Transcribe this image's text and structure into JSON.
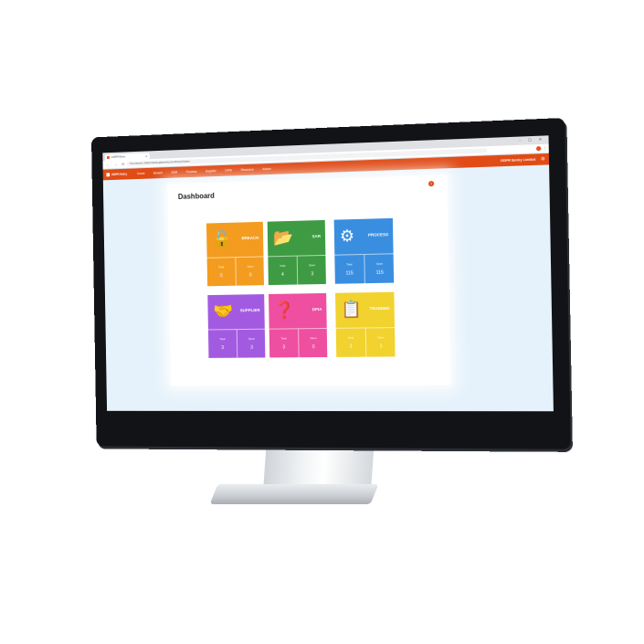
{
  "browser": {
    "tab_title": "GDPR Entry",
    "tab_close": "×",
    "window_controls": "– ▢ ✕",
    "nav_glyphs": "← → ⟳",
    "url": "Not secure | https://www.gdprentry.com/Home/Index",
    "menu_glyph": "⋮"
  },
  "app": {
    "brand": "GDPR Entry",
    "menu": [
      "Home",
      "Breach",
      "SAR",
      "Process",
      "Supplier",
      "DPIA",
      "Resource",
      "Admin"
    ],
    "company": "GDPR Sentry Limited",
    "settings_glyph": "⚙",
    "notification_count": "1"
  },
  "dashboard": {
    "title": "Dashboard",
    "tiles": [
      {
        "name": "BREACH",
        "icon": "lock-open-icon",
        "glyph": "🔓",
        "color": "#f39c1f",
        "left_label": "Total",
        "left_value": "0",
        "right_label": "Open",
        "right_value": "0"
      },
      {
        "name": "SAR",
        "icon": "folder-icon",
        "glyph": "📂",
        "color": "#3e9b43",
        "left_label": "Total",
        "left_value": "4",
        "right_label": "Open",
        "right_value": "3"
      },
      {
        "name": "PROCESS",
        "icon": "gears-icon",
        "glyph": "⚙",
        "color": "#3a8ee0",
        "left_label": "Total",
        "left_value": "115",
        "right_label": "Open",
        "right_value": "115"
      },
      {
        "name": "SUPPLIER",
        "icon": "handshake-icon",
        "glyph": "🤝",
        "color": "#a25be0",
        "left_label": "Total",
        "left_value": "3",
        "right_label": "Open",
        "right_value": "3"
      },
      {
        "name": "DPIA",
        "icon": "question-person-icon",
        "glyph": "❓",
        "color": "#ee4fa0",
        "left_label": "Total",
        "left_value": "3",
        "right_label": "Open",
        "right_value": "0"
      },
      {
        "name": "TRAINING",
        "icon": "presentation-icon",
        "glyph": "📋",
        "color": "#f2d22e",
        "left_label": "Total",
        "left_value": "2",
        "right_label": "Open",
        "right_value": "1"
      }
    ]
  }
}
